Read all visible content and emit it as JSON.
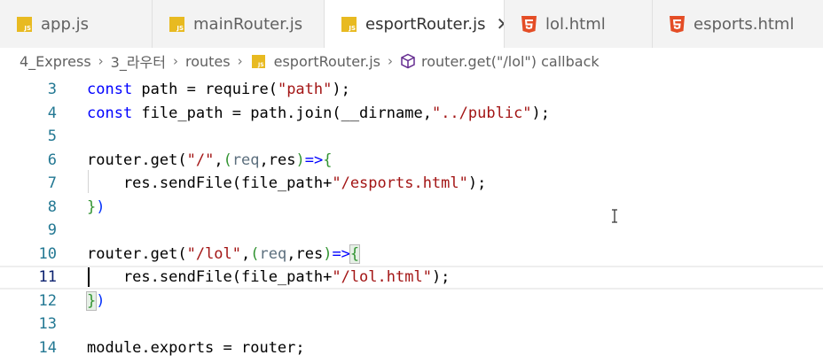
{
  "tabs": [
    {
      "label": "app.js",
      "icon": "js-file-icon",
      "active": false
    },
    {
      "label": "mainRouter.js",
      "icon": "js-file-icon",
      "active": false
    },
    {
      "label": "esportRouter.js",
      "icon": "js-file-icon",
      "active": true
    },
    {
      "label": "lol.html",
      "icon": "html-file-icon",
      "active": false
    },
    {
      "label": "esports.html",
      "icon": "html-file-icon",
      "active": false
    }
  ],
  "close_glyph": "✕",
  "breadcrumb": {
    "items": [
      "4_Express",
      "3_라우터",
      "routes",
      "esportRouter.js",
      "router.get(\"/lol\") callback"
    ],
    "separator": "›"
  },
  "editor": {
    "lines": [
      {
        "n": "3"
      },
      {
        "n": "4"
      },
      {
        "n": "5"
      },
      {
        "n": "6"
      },
      {
        "n": "7"
      },
      {
        "n": "8"
      },
      {
        "n": "9"
      },
      {
        "n": "10"
      },
      {
        "n": "11"
      },
      {
        "n": "12"
      },
      {
        "n": "13"
      },
      {
        "n": "14"
      }
    ],
    "tokens": {
      "l3": [
        "const",
        " path = require(",
        "\"path\"",
        ");"
      ],
      "l4": [
        "const",
        " file_path = path.join(__dirname,",
        "\"../public\"",
        ");"
      ],
      "l6": [
        "router.get(",
        "\"/\"",
        ",",
        "(",
        "req",
        ",res",
        ")",
        "=>",
        "{"
      ],
      "l7": [
        "    res.sendFile(file_path+",
        "\"/esports.html\"",
        ");"
      ],
      "l8": [
        "}",
        ")"
      ],
      "l10": [
        "router.get(",
        "\"/lol\"",
        ",",
        "(",
        "req",
        ",res",
        ")",
        "=>",
        "{"
      ],
      "l11": [
        "    res.sendFile(file_path+",
        "\"/lol.html\"",
        ");"
      ],
      "l12": [
        "}",
        ")"
      ],
      "l14": [
        "module.exports = router;"
      ]
    },
    "current_line": "11"
  },
  "colors": {
    "keyword": "#0000ff",
    "string": "#a31515",
    "line_number": "#237893",
    "js_icon": "#e8ba21",
    "html_icon": "#e44d26"
  }
}
